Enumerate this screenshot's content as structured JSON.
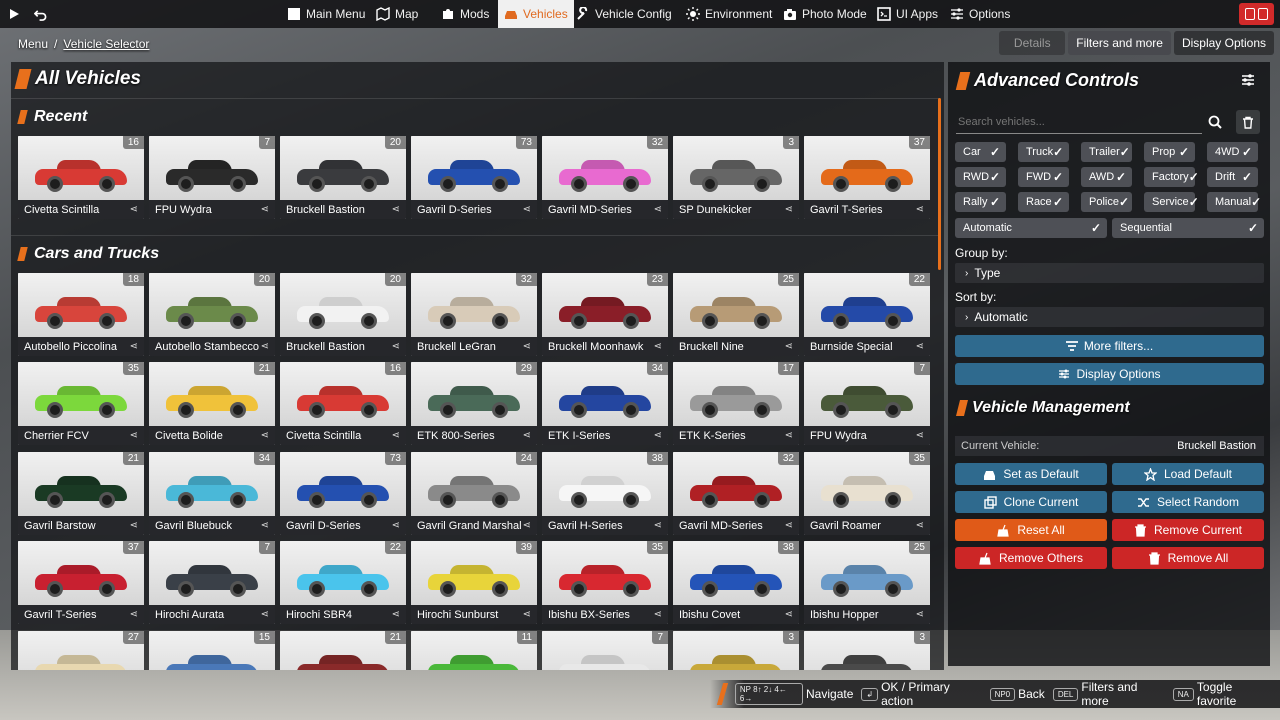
{
  "topbar": {
    "nav": [
      {
        "label": "Main Menu",
        "icon": "home-icon"
      },
      {
        "label": "Map",
        "icon": "map-icon"
      },
      {
        "label": "Mods",
        "icon": "puzzle-icon"
      },
      {
        "label": "Vehicles",
        "icon": "car-icon",
        "active": true
      },
      {
        "label": "Vehicle Config",
        "icon": "wrench-icon"
      },
      {
        "label": "Environment",
        "icon": "sun-icon"
      },
      {
        "label": "Photo Mode",
        "icon": "camera-icon"
      },
      {
        "label": "UI Apps",
        "icon": "apps-icon"
      },
      {
        "label": "Options",
        "icon": "sliders-icon"
      }
    ]
  },
  "breadcrumb": {
    "root": "Menu",
    "sep": "/",
    "current": "Vehicle Selector"
  },
  "right_tabs": [
    "Details",
    "Filters and more",
    "Display Options"
  ],
  "left": {
    "title": "All Vehicles",
    "recent_title": "Recent",
    "recent": [
      {
        "name": "Civetta Scintilla",
        "count": "16",
        "color": "#d83a34"
      },
      {
        "name": "FPU Wydra",
        "count": "7",
        "color": "#2a2a2a"
      },
      {
        "name": "Bruckell Bastion",
        "count": "20",
        "color": "#3a3b3e"
      },
      {
        "name": "Gavril D-Series",
        "count": "73",
        "color": "#2450b0"
      },
      {
        "name": "Gavril MD-Series",
        "count": "32",
        "color": "#e86ad0"
      },
      {
        "name": "SP Dunekicker",
        "count": "3",
        "color": "#666666"
      },
      {
        "name": "Gavril T-Series",
        "count": "37",
        "color": "#e46a1a"
      }
    ],
    "cars_title": "Cars and Trucks",
    "cars": [
      {
        "name": "Autobello Piccolina",
        "count": "18",
        "color": "#d8453c"
      },
      {
        "name": "Autobello Stambecco",
        "count": "20",
        "color": "#6b8a4a"
      },
      {
        "name": "Bruckell Bastion",
        "count": "20",
        "color": "#f2f2f2"
      },
      {
        "name": "Bruckell LeGran",
        "count": "32",
        "color": "#d8cbb8"
      },
      {
        "name": "Bruckell Moonhawk",
        "count": "23",
        "color": "#8a1e28"
      },
      {
        "name": "Bruckell Nine",
        "count": "25",
        "color": "#b79b76"
      },
      {
        "name": "Burnside Special",
        "count": "22",
        "color": "#244aa8"
      },
      {
        "name": "Cherrier FCV",
        "count": "35",
        "color": "#7cd83c"
      },
      {
        "name": "Civetta Bolide",
        "count": "21",
        "color": "#f0c23a"
      },
      {
        "name": "Civetta Scintilla",
        "count": "16",
        "color": "#d83a34"
      },
      {
        "name": "ETK 800-Series",
        "count": "29",
        "color": "#4a6a58"
      },
      {
        "name": "ETK I-Series",
        "count": "34",
        "color": "#2446a0"
      },
      {
        "name": "ETK K-Series",
        "count": "17",
        "color": "#9a9a9a"
      },
      {
        "name": "FPU Wydra",
        "count": "7",
        "color": "#4a5a3a"
      },
      {
        "name": "Gavril Barstow",
        "count": "21",
        "color": "#1a3a24"
      },
      {
        "name": "Gavril Bluebuck",
        "count": "34",
        "color": "#4ab8d8"
      },
      {
        "name": "Gavril D-Series",
        "count": "73",
        "color": "#2450b0"
      },
      {
        "name": "Gavril Grand Marshal",
        "count": "24",
        "color": "#8a8a8a"
      },
      {
        "name": "Gavril H-Series",
        "count": "38",
        "color": "#f6f6f6"
      },
      {
        "name": "Gavril MD-Series",
        "count": "32",
        "color": "#b02024"
      },
      {
        "name": "Gavril Roamer",
        "count": "35",
        "color": "#e8e0d0"
      },
      {
        "name": "Gavril T-Series",
        "count": "37",
        "color": "#c82030"
      },
      {
        "name": "Hirochi Aurata",
        "count": "7",
        "color": "#3a4048"
      },
      {
        "name": "Hirochi SBR4",
        "count": "22",
        "color": "#4ac4ec"
      },
      {
        "name": "Hirochi Sunburst",
        "count": "39",
        "color": "#e8d43a"
      },
      {
        "name": "Ibishu BX-Series",
        "count": "35",
        "color": "#d82830"
      },
      {
        "name": "Ibishu Covet",
        "count": "38",
        "color": "#2454b8"
      },
      {
        "name": "Ibishu Hopper",
        "count": "25",
        "color": "#6a9ac8"
      },
      {
        "name": "",
        "count": "27",
        "color": "#e8d8b0"
      },
      {
        "name": "",
        "count": "15",
        "color": "#4a78b8"
      },
      {
        "name": "",
        "count": "21",
        "color": "#8a2a2a"
      },
      {
        "name": "",
        "count": "11",
        "color": "#4ab83a"
      },
      {
        "name": "",
        "count": "7",
        "color": "#e8e8e8"
      },
      {
        "name": "",
        "count": "3",
        "color": "#c8a83a"
      },
      {
        "name": "",
        "count": "3",
        "color": "#4a4a4a"
      }
    ]
  },
  "right": {
    "title": "Advanced Controls",
    "search_placeholder": "Search vehicles...",
    "filters": [
      [
        "Car",
        "Truck",
        "Trailer",
        "Prop",
        "4WD"
      ],
      [
        "RWD",
        "FWD",
        "AWD",
        "Factory",
        "Drift"
      ],
      [
        "Rally",
        "Race",
        "Police",
        "Service",
        "Manual"
      ],
      [
        "Automatic",
        "Sequential"
      ]
    ],
    "check": "✓",
    "group_by_label": "Group by:",
    "group_by_value": "Type",
    "sort_by_label": "Sort by:",
    "sort_by_value": "Automatic",
    "more_filters": "More filters...",
    "display_options": "Display Options",
    "vm_title": "Vehicle Management",
    "current_vehicle_label": "Current Vehicle:",
    "current_vehicle_value": "Bruckell Bastion",
    "actions": [
      {
        "label": "Set as Default",
        "style": "blue"
      },
      {
        "label": "Load Default",
        "style": "blue"
      },
      {
        "label": "Clone Current",
        "style": "blue"
      },
      {
        "label": "Select Random",
        "style": "blue"
      },
      {
        "label": "Reset All",
        "style": "orange"
      },
      {
        "label": "Remove Current",
        "style": "red"
      },
      {
        "label": "Remove Others",
        "style": "red"
      },
      {
        "label": "Remove All",
        "style": "red"
      }
    ]
  },
  "hints": [
    {
      "keys": "NP 8↑ 2↓ 4← 6→",
      "label": "Navigate"
    },
    {
      "keys": "↲",
      "label": "OK / Primary action"
    },
    {
      "keys": "NP0",
      "label": "Back"
    },
    {
      "keys": "DEL",
      "label": "Filters and more"
    },
    {
      "keys": "NA",
      "label": "Toggle favorite"
    }
  ]
}
